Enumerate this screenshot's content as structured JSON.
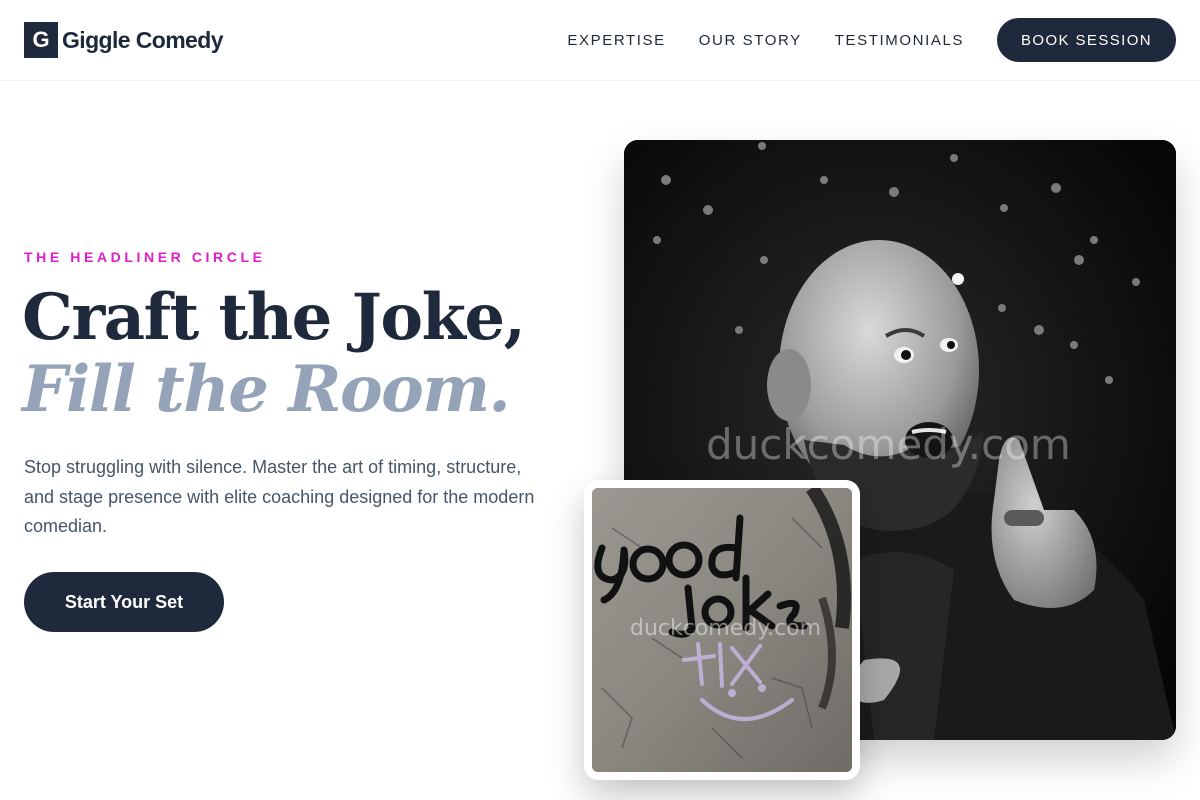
{
  "brand": {
    "logo_letter": "G",
    "name": "Giggle Comedy"
  },
  "nav": {
    "links": [
      "EXPERTISE",
      "OUR STORY",
      "TESTIMONIALS"
    ],
    "cta": "BOOK SESSION"
  },
  "hero": {
    "eyebrow": "THE HEADLINER CIRCLE",
    "headline_line1": "Craft the Joke,",
    "headline_line2": "Fill the Room.",
    "subtext": "Stop struggling with silence. Master the art of timing, structure, and stage presence with elite coaching designed for the modern comedian.",
    "cta": "Start Your Set"
  },
  "images": {
    "main_watermark": "duckcomedy.com",
    "small_watermark": "duckcomedy.com",
    "graffiti_line1": "good",
    "graffiti_line2": "joke",
    "graffiti_tag": "+lix"
  },
  "colors": {
    "primary": "#1e293b",
    "accent": "#e11dcb",
    "muted": "#94a3b8"
  }
}
